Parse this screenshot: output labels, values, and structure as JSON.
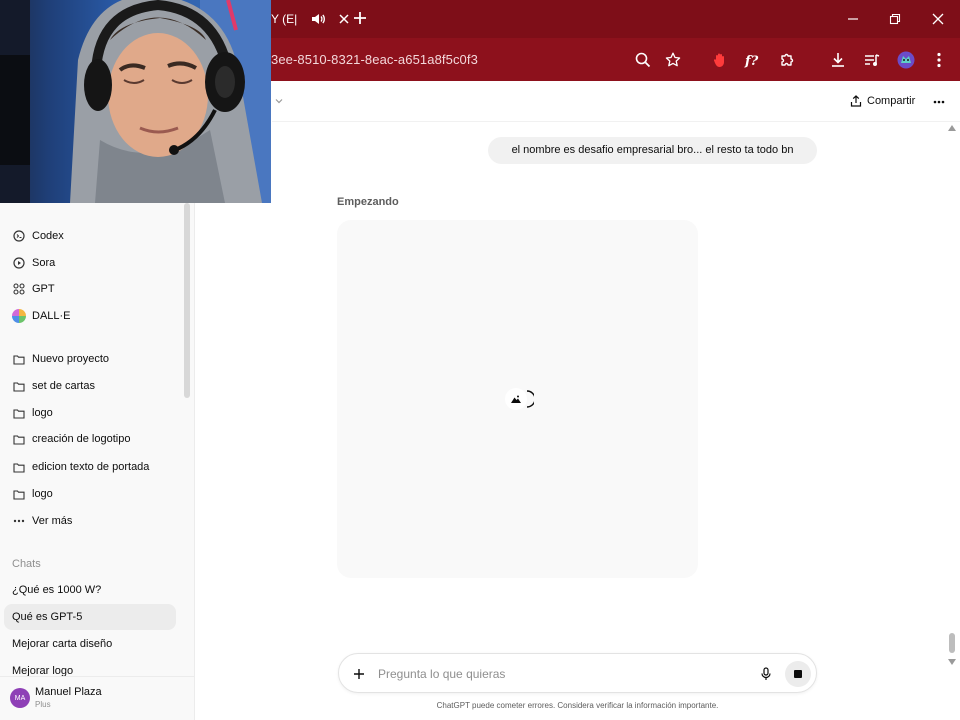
{
  "browser": {
    "tab_fragment": "Y (E|",
    "url_fragment": "3ee-8510-8321-8eac-a651a8f5c0f3",
    "accent": "#7e0e18"
  },
  "sidebar": {
    "items": [
      {
        "label": "Codex",
        "icon": "codex-icon"
      },
      {
        "label": "Sora",
        "icon": "play-circle-icon"
      },
      {
        "label": "GPT",
        "icon": "grid-icon"
      },
      {
        "label": "DALL·E",
        "icon": "dalle-logo-icon"
      }
    ],
    "projects": [
      {
        "label": "Nuevo proyecto",
        "icon": "folder-plus-icon"
      },
      {
        "label": "set de cartas",
        "icon": "folder-icon"
      },
      {
        "label": "logo",
        "icon": "folder-icon"
      },
      {
        "label": "creación de logotipo",
        "icon": "folder-icon"
      },
      {
        "label": "edicion texto de portada",
        "icon": "folder-icon"
      },
      {
        "label": "logo",
        "icon": "folder-icon"
      }
    ],
    "more_label": "Ver más",
    "chats_heading": "Chats",
    "chats": [
      {
        "label": "¿Qué es 1000 W?"
      },
      {
        "label": "Qué es GPT-5",
        "active": true
      },
      {
        "label": "Mejorar carta diseño"
      },
      {
        "label": "Mejorar logo"
      }
    ],
    "user": {
      "initials": "MA",
      "name": "Manuel Plaza",
      "plan": "Plus"
    }
  },
  "header": {
    "share_label": "Compartir"
  },
  "conversation": {
    "user_message": "el nombre es desafio empresarial bro... el resto ta todo bn",
    "status": "Empezando"
  },
  "composer": {
    "placeholder": "Pregunta lo que quieras",
    "disclaimer": "ChatGPT puede cometer errores. Considera verificar la información importante."
  }
}
